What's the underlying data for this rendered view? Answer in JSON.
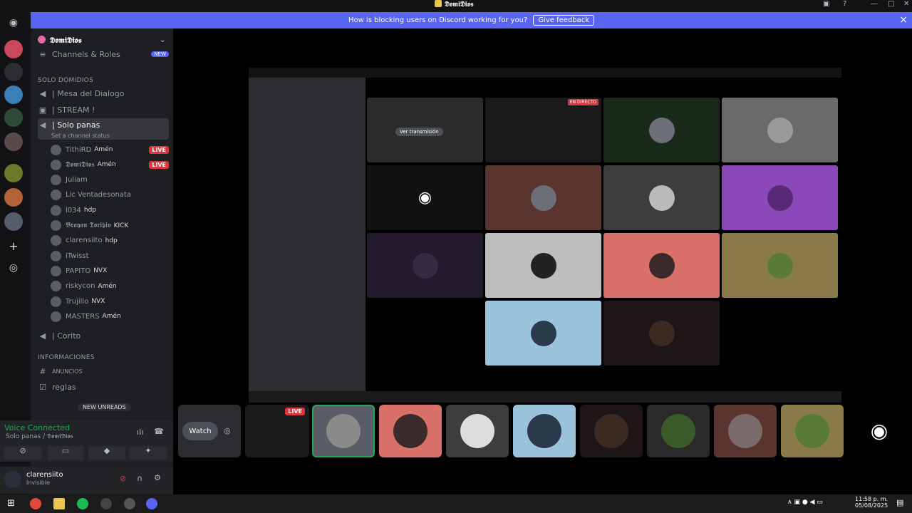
{
  "window": {
    "title": "𝕯𝖔𝖒𝖎𝕯𝖎𝖔𝖘"
  },
  "banner": {
    "text": "How is blocking users on Discord working for you?",
    "button": "Give feedback"
  },
  "server": {
    "name": "𝕯𝖔𝖒𝖎𝕯𝖎𝖔𝖘"
  },
  "sidebar": {
    "top_item": "Channels & Roles",
    "top_badge": "NEW",
    "cat1": "SOLO DOMIDIOS",
    "ch1": "| Mesa del Dialogo",
    "ch2": "| STREAM !",
    "ch3": "| Solo panas",
    "ch3_status": "Set a channel status",
    "users": [
      {
        "name": "TithiRD",
        "tag": "Amén",
        "live": "LIVE"
      },
      {
        "name": "𝕯𝖔𝖒𝖎𝕯𝖎𝖔𝖘",
        "tag": "Amén",
        "live": "LIVE"
      },
      {
        "name": "Juliam",
        "tag": "",
        "live": ""
      },
      {
        "name": "Lic Ventadesonata",
        "tag": "",
        "live": ""
      },
      {
        "name": "l034",
        "tag": "hdp",
        "live": ""
      },
      {
        "name": "𝕭𝖗𝖆𝖞𝖆𝖓 𝕿𝖔𝖗𝖎𝖇𝖎𝖔",
        "tag": "KICK",
        "live": ""
      },
      {
        "name": "clarensiito",
        "tag": "hdp",
        "live": ""
      },
      {
        "name": "iTwisst",
        "tag": "",
        "live": ""
      },
      {
        "name": "PAPITO",
        "tag": "NVX",
        "live": ""
      },
      {
        "name": "riskycon",
        "tag": "Amén",
        "live": ""
      },
      {
        "name": "Trujillo",
        "tag": "NVX",
        "live": ""
      },
      {
        "name": "MASTERS",
        "tag": "Amén",
        "live": ""
      }
    ],
    "ch4": "| Corito",
    "cat2": "INFORMACIONES",
    "ch5": "ANUNCIOS",
    "ch6": "reglas",
    "new_unreads": "NEW UNREADS"
  },
  "voice": {
    "status": "Voice Connected",
    "channel": "Solo panas / 𝕯𝖔𝖒𝖎𝕯𝖎𝖔𝖘"
  },
  "me": {
    "name": "clarensiito",
    "status": "Invisible"
  },
  "stage": {
    "watch": "Watch",
    "live": "LIVE",
    "inner_cta": "Ver transmisión",
    "inner_live": "EN DIRECTO"
  },
  "taskbar": {
    "time": "11:58 p. m.",
    "date": "05/08/2025"
  }
}
